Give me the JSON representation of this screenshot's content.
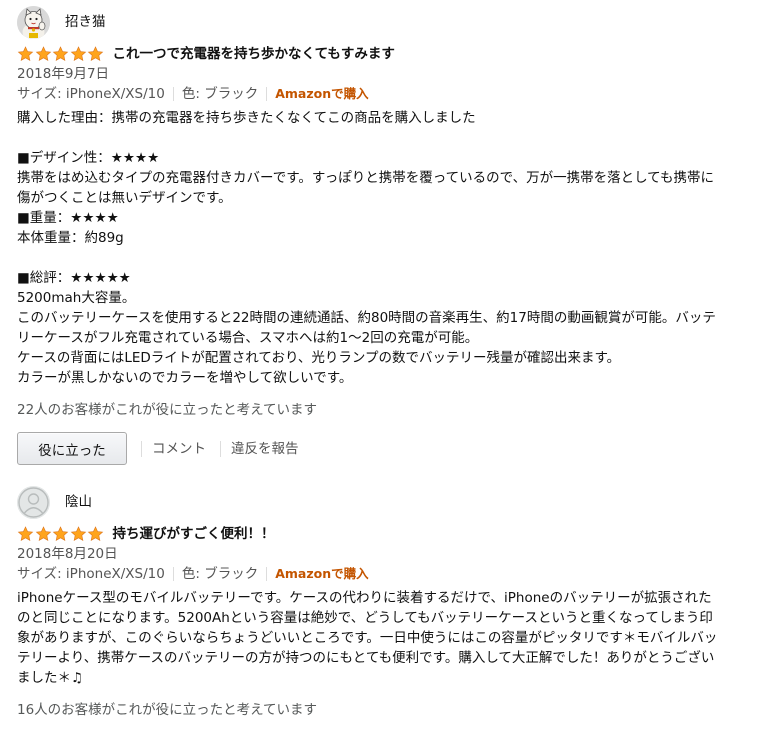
{
  "colors": {
    "star": "#ffa41c",
    "verified": "#c45500",
    "meta": "#555555"
  },
  "reviews": [
    {
      "author": "招き猫",
      "avatar_icon": "lucky-cat-avatar-icon",
      "stars": 5,
      "title": "これ一つで充電器を持ち歩かなくてもすみます",
      "date": "2018年9月7日",
      "size": "サイズ: iPhoneX/XS/10",
      "color": "色: ブラック",
      "verified": "Amazonで購入",
      "body": [
        "購入した理由：携帯の充電器を持ち歩きたくなくてこの商品を購入しました",
        "",
        "■デザイン性：★★★★",
        "携帯をはめ込むタイプの充電器付きカバーです。すっぽりと携帯を覆っているので、万が一携帯を落としても携帯に",
        "傷がつくことは無いデザインです。",
        "■重量：★★★★",
        "本体重量：約89g",
        "",
        "■総評：★★★★★",
        "5200mah大容量。",
        "このバッテリーケースを使用すると22時間の連続通話、約80時間の音楽再生、約17時間の動画観賞が可能。バッテ",
        "リーケースがフル充電されている場合、スマホへは約1～2回の充電が可能。",
        "ケースの背面にはLEDライトが配置されており、光りランプの数でバッテリー残量が確認出来ます。",
        "カラーが黒しかないのでカラーを増やして欲しいです。"
      ],
      "helpful": "22人のお客様がこれが役に立ったと考えています",
      "helpful_button": "役に立った",
      "comment_link": "コメント",
      "report_link": "違反を報告"
    },
    {
      "author": "陰山",
      "avatar_icon": "default-user-avatar-icon",
      "stars": 5,
      "title": "持ち運びがすごく便利！！",
      "date": "2018年8月20日",
      "size": "サイズ: iPhoneX/XS/10",
      "color": "色: ブラック",
      "verified": "Amazonで購入",
      "body": [
        "iPhoneケース型のモバイルバッテリーです。ケースの代わりに装着するだけで、iPhoneのバッテリーが拡張された",
        "のと同じことになります。5200Ahという容量は絶妙で、どうしてもバッテリーケースというと重くなってしまう印",
        "象がありますが、このぐらいならちょうどいいところです。一日中使うにはこの容量がピッタリです＊モバイルバッ",
        "テリーより、携帯ケースのバッテリーの方が持つのにもとても便利です。購入して大正解でした！ありがとうござい",
        "ました＊♫"
      ],
      "helpful": "16人のお客様がこれが役に立ったと考えています"
    }
  ]
}
